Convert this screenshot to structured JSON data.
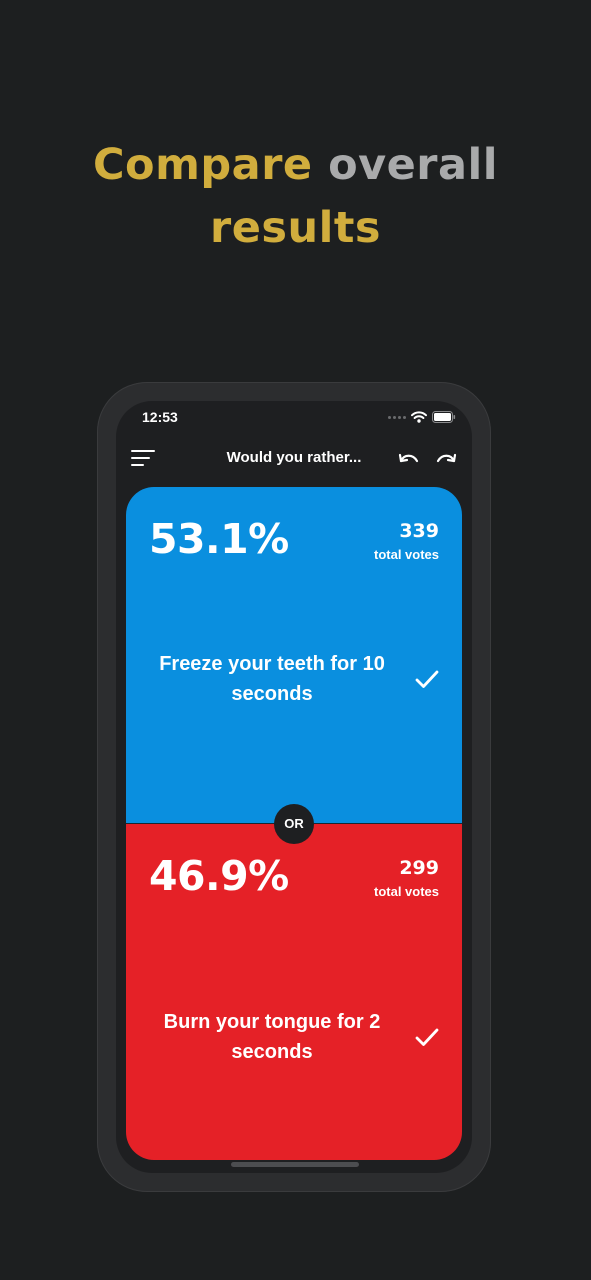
{
  "headline": {
    "word1": "Compare",
    "word2": "overall",
    "word3": "results"
  },
  "colors": {
    "background": "#1d1f20",
    "headline_gold": "#d1ad3d",
    "headline_grey": "#a9aaab",
    "option_a": "#0a8fdf",
    "option_b": "#e52127"
  },
  "status_bar": {
    "time": "12:53",
    "icons": [
      "cellular-signal-icon",
      "wifi-icon",
      "battery-icon"
    ]
  },
  "header": {
    "title": "Would you rather...",
    "menu_icon": "menu-icon",
    "undo_icon": "undo-icon",
    "redo_icon": "redo-icon"
  },
  "option_a": {
    "percent": "53.1%",
    "votes": "339",
    "votes_label": "total votes",
    "text": "Freeze your teeth for 10 seconds",
    "icon": "checkmark-icon"
  },
  "option_b": {
    "percent": "46.9%",
    "votes": "299",
    "votes_label": "total votes",
    "text": "Burn your tongue for 2 seconds",
    "icon": "checkmark-icon"
  },
  "divider_label": "OR"
}
